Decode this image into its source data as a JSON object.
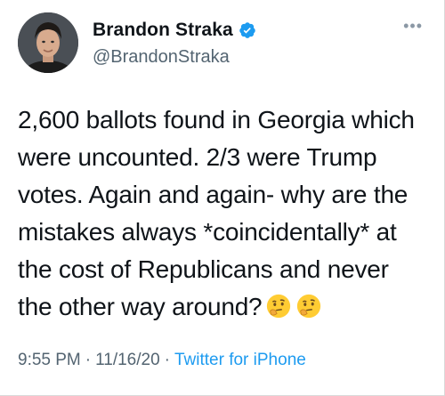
{
  "author": {
    "name": "Brandon Straka",
    "handle": "@BrandonStraka",
    "verified_icon": "verified-badge-icon",
    "avatar_icon": "profile-photo"
  },
  "more_icon": "more-options-icon",
  "tweet": {
    "lines": [
      "2,600 ballots found in Georgia which",
      "were uncounted. 2/3 were Trump",
      "votes. Again and again- why are the",
      "mistakes always *coincidentally* at",
      "the cost of Republicans and never",
      "the other way around?"
    ],
    "emojis": [
      "thinking-face-icon",
      "thinking-face-icon"
    ]
  },
  "meta": {
    "time": "9:55 PM",
    "separator": "·",
    "date": "11/16/20",
    "source": "Twitter for iPhone"
  },
  "colors": {
    "link_blue": "#1d9bf0",
    "muted": "#536471",
    "text": "#0f1419"
  }
}
